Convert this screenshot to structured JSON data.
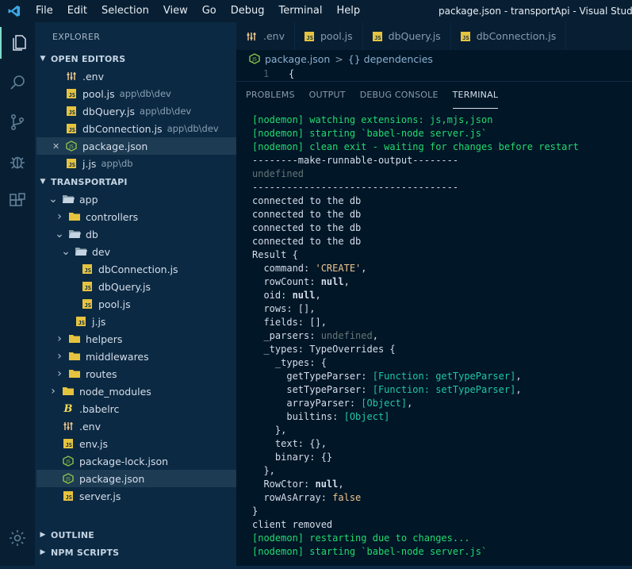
{
  "menu": [
    "File",
    "Edit",
    "Selection",
    "View",
    "Go",
    "Debug",
    "Terminal",
    "Help"
  ],
  "window_title": "package.json - transportApi - Visual Studio Co",
  "activity_icons": [
    "files-icon",
    "search-icon",
    "source-control-icon",
    "debug-icon",
    "extensions-icon",
    "settings-gear-icon"
  ],
  "explorer": {
    "title": "EXPLORER",
    "open_editors_label": "OPEN EDITORS",
    "open_editors": [
      {
        "name": ".env",
        "path": "",
        "type": "env"
      },
      {
        "name": "pool.js",
        "path": "app\\db\\dev",
        "type": "js"
      },
      {
        "name": "dbQuery.js",
        "path": "app\\db\\dev",
        "type": "js"
      },
      {
        "name": "dbConnection.js",
        "path": "app\\db\\dev",
        "type": "js"
      },
      {
        "name": "package.json",
        "path": "",
        "type": "json"
      },
      {
        "name": "j.js",
        "path": "app\\db",
        "type": "js"
      }
    ],
    "project_label": "TRANSPORTAPI",
    "tree": [
      {
        "name": "app",
        "depth": 1,
        "type": "folder-open",
        "chev": "v"
      },
      {
        "name": "controllers",
        "depth": 2,
        "type": "folder",
        "chev": ">"
      },
      {
        "name": "db",
        "depth": 2,
        "type": "folder-open",
        "chev": "v"
      },
      {
        "name": "dev",
        "depth": 3,
        "type": "folder-open",
        "chev": "v"
      },
      {
        "name": "dbConnection.js",
        "depth": 4,
        "type": "js",
        "chev": ""
      },
      {
        "name": "dbQuery.js",
        "depth": 4,
        "type": "js",
        "chev": ""
      },
      {
        "name": "pool.js",
        "depth": 4,
        "type": "js",
        "chev": ""
      },
      {
        "name": "j.js",
        "depth": 3,
        "type": "js",
        "chev": ""
      },
      {
        "name": "helpers",
        "depth": 2,
        "type": "folder",
        "chev": ">"
      },
      {
        "name": "middlewares",
        "depth": 2,
        "type": "folder",
        "chev": ">"
      },
      {
        "name": "routes",
        "depth": 2,
        "type": "folder",
        "chev": ">"
      },
      {
        "name": "node_modules",
        "depth": 1,
        "type": "folder",
        "chev": ">"
      },
      {
        "name": ".babelrc",
        "depth": 1,
        "type": "babel",
        "chev": ""
      },
      {
        "name": ".env",
        "depth": 1,
        "type": "env",
        "chev": ""
      },
      {
        "name": "env.js",
        "depth": 1,
        "type": "js",
        "chev": ""
      },
      {
        "name": "package-lock.json",
        "depth": 1,
        "type": "json",
        "chev": ""
      },
      {
        "name": "package.json",
        "depth": 1,
        "type": "json",
        "chev": ""
      },
      {
        "name": "server.js",
        "depth": 1,
        "type": "js",
        "chev": ""
      }
    ],
    "outline_label": "OUTLINE",
    "npm_scripts_label": "NPM SCRIPTS"
  },
  "tabs": [
    {
      "name": ".env",
      "type": "env"
    },
    {
      "name": "pool.js",
      "type": "js"
    },
    {
      "name": "dbQuery.js",
      "type": "js"
    },
    {
      "name": "dbConnection.js",
      "type": "js"
    }
  ],
  "breadcrumb": {
    "file": "package.json",
    "sep": ">",
    "symbol": "{} dependencies"
  },
  "code": {
    "line_number": "1",
    "text": "{"
  },
  "panel_tabs": [
    "PROBLEMS",
    "OUTPUT",
    "DEBUG CONSOLE",
    "TERMINAL"
  ],
  "terminal_lines": [
    "[nodemon] watching extensions: js,mjs,json",
    "[nodemon] starting `babel-node server.js`",
    "[nodemon] clean exit - waiting for changes before restart",
    "--------make-runnable-output--------",
    "undefined",
    "------------------------------------",
    "connected to the db",
    "connected to the db",
    "connected to the db",
    "connected to the db",
    "Result {",
    "  command: 'CREATE',",
    "  rowCount: null,",
    "  oid: null,",
    "  rows: [],",
    "  fields: [],",
    "  _parsers: undefined,",
    "  _types: TypeOverrides {",
    "    _types: {",
    "      getTypeParser: [Function: getTypeParser],",
    "      setTypeParser: [Function: setTypeParser],",
    "      arrayParser: [Object],",
    "      builtins: [Object]",
    "    },",
    "    text: {},",
    "    binary: {}",
    "  },",
    "  RowCtor: null,",
    "  rowAsArray: false",
    "}",
    "client removed",
    "[nodemon] restarting due to changes...",
    "[nodemon] starting `babel-node server.js`"
  ],
  "colors": {
    "accent": "#7fdbca",
    "nodemon": "#22da6e",
    "js_badge": "#e6c33f"
  }
}
